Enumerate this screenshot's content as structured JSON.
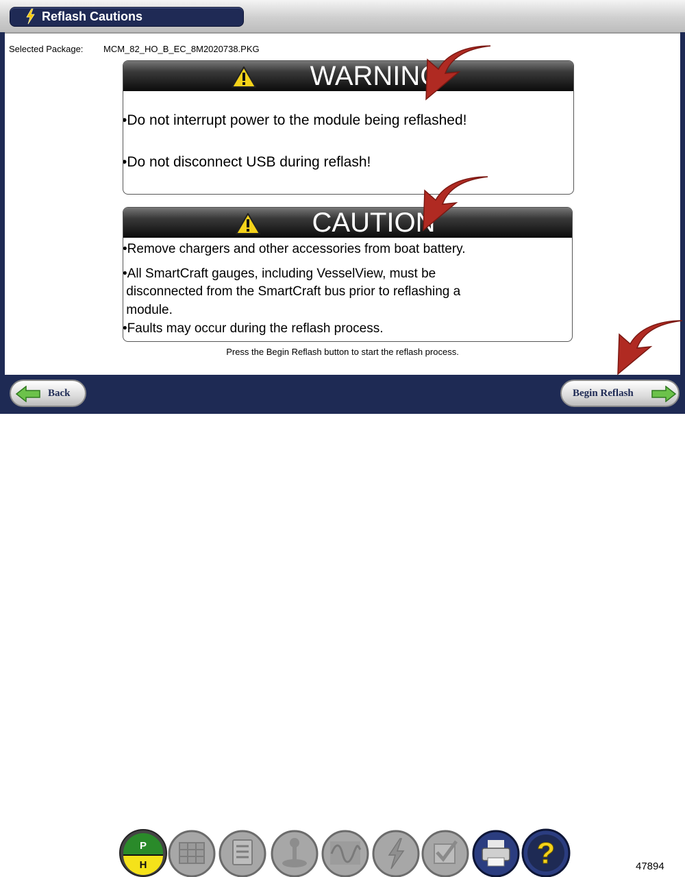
{
  "window": {
    "title": "Reflash Cautions"
  },
  "package": {
    "label": "Selected Package:",
    "value": "MCM_82_HO_B_EC_8M2020738.PKG"
  },
  "warning": {
    "heading": "WARNING",
    "lines": [
      "•Do not interrupt power to the module being reflashed!",
      "•Do not disconnect USB during reflash!"
    ]
  },
  "caution": {
    "heading": "CAUTION",
    "lines": [
      "•Remove chargers and other accessories from boat battery.",
      "•All SmartCraft gauges, including VesselView, must be",
      " disconnected from the SmartCraft bus prior to reflashing a",
      " module.",
      "•Faults may occur during the reflash process."
    ]
  },
  "hint": "Press the Begin Reflash button to start the reflash process.",
  "nav": {
    "back_label": "Back",
    "begin_label": "Begin Reflash"
  },
  "toolbar": {
    "items": [
      {
        "name": "ph-mode-button",
        "top": "P",
        "bottom": "H"
      },
      {
        "name": "grid-icon"
      },
      {
        "name": "checklist-icon"
      },
      {
        "name": "joystick-icon"
      },
      {
        "name": "waveform-icon"
      },
      {
        "name": "lightning-icon"
      },
      {
        "name": "checkmark-icon"
      },
      {
        "name": "printer-icon"
      },
      {
        "name": "help-icon",
        "label": "?"
      }
    ]
  },
  "reference_number": "47894",
  "colors": {
    "navy": "#1e2a54",
    "arrow_red": "#b02a22",
    "warning_yellow": "#f5d21a"
  }
}
